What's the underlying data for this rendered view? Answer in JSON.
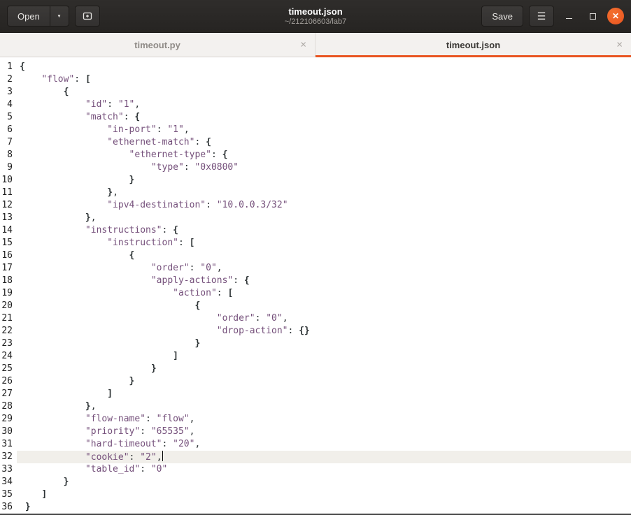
{
  "header": {
    "open_label": "Open",
    "title": "timeout.json",
    "subtitle": "~/212106603/lab7",
    "save_label": "Save"
  },
  "icons": {
    "open_dropdown": "▼",
    "menu": "☰",
    "close_window": "✕",
    "tab_close": "×"
  },
  "tabs": [
    {
      "label": "timeout.py",
      "active": false
    },
    {
      "label": "timeout.json",
      "active": true
    }
  ],
  "editor": {
    "language": "json",
    "current_line": 32,
    "lines": [
      [
        [
          "{",
          "b"
        ]
      ],
      [
        [
          "    ",
          "p"
        ],
        [
          "\"flow\"",
          "s"
        ],
        [
          ": ",
          "p"
        ],
        [
          "[",
          "b"
        ]
      ],
      [
        [
          "        ",
          "p"
        ],
        [
          "{",
          "b"
        ]
      ],
      [
        [
          "            ",
          "p"
        ],
        [
          "\"id\"",
          "s"
        ],
        [
          ": ",
          "p"
        ],
        [
          "\"1\"",
          "s"
        ],
        [
          ",",
          "p"
        ]
      ],
      [
        [
          "            ",
          "p"
        ],
        [
          "\"match\"",
          "s"
        ],
        [
          ": ",
          "p"
        ],
        [
          "{",
          "b"
        ]
      ],
      [
        [
          "                ",
          "p"
        ],
        [
          "\"in-port\"",
          "s"
        ],
        [
          ": ",
          "p"
        ],
        [
          "\"1\"",
          "s"
        ],
        [
          ",",
          "p"
        ]
      ],
      [
        [
          "                ",
          "p"
        ],
        [
          "\"ethernet-match\"",
          "s"
        ],
        [
          ": ",
          "p"
        ],
        [
          "{",
          "b"
        ]
      ],
      [
        [
          "                    ",
          "p"
        ],
        [
          "\"ethernet-type\"",
          "s"
        ],
        [
          ": ",
          "p"
        ],
        [
          "{",
          "b"
        ]
      ],
      [
        [
          "                        ",
          "p"
        ],
        [
          "\"type\"",
          "s"
        ],
        [
          ": ",
          "p"
        ],
        [
          "\"0x0800\"",
          "s"
        ]
      ],
      [
        [
          "                    ",
          "p"
        ],
        [
          "}",
          "b"
        ]
      ],
      [
        [
          "                ",
          "p"
        ],
        [
          "}",
          "b"
        ],
        [
          ",",
          "p"
        ]
      ],
      [
        [
          "                ",
          "p"
        ],
        [
          "\"ipv4-destination\"",
          "s"
        ],
        [
          ": ",
          "p"
        ],
        [
          "\"10.0.0.3/32\"",
          "s"
        ]
      ],
      [
        [
          "            ",
          "p"
        ],
        [
          "}",
          "b"
        ],
        [
          ",",
          "p"
        ]
      ],
      [
        [
          "            ",
          "p"
        ],
        [
          "\"instructions\"",
          "s"
        ],
        [
          ": ",
          "p"
        ],
        [
          "{",
          "b"
        ]
      ],
      [
        [
          "                ",
          "p"
        ],
        [
          "\"instruction\"",
          "s"
        ],
        [
          ": ",
          "p"
        ],
        [
          "[",
          "b"
        ]
      ],
      [
        [
          "                    ",
          "p"
        ],
        [
          "{",
          "b"
        ]
      ],
      [
        [
          "                        ",
          "p"
        ],
        [
          "\"order\"",
          "s"
        ],
        [
          ": ",
          "p"
        ],
        [
          "\"0\"",
          "s"
        ],
        [
          ",",
          "p"
        ]
      ],
      [
        [
          "                        ",
          "p"
        ],
        [
          "\"apply-actions\"",
          "s"
        ],
        [
          ": ",
          "p"
        ],
        [
          "{",
          "b"
        ]
      ],
      [
        [
          "                            ",
          "p"
        ],
        [
          "\"action\"",
          "s"
        ],
        [
          ": ",
          "p"
        ],
        [
          "[",
          "b"
        ]
      ],
      [
        [
          "                                ",
          "p"
        ],
        [
          "{",
          "b"
        ]
      ],
      [
        [
          "                                    ",
          "p"
        ],
        [
          "\"order\"",
          "s"
        ],
        [
          ": ",
          "p"
        ],
        [
          "\"0\"",
          "s"
        ],
        [
          ",",
          "p"
        ]
      ],
      [
        [
          "                                    ",
          "p"
        ],
        [
          "\"drop-action\"",
          "s"
        ],
        [
          ": ",
          "p"
        ],
        [
          "{}",
          "b"
        ]
      ],
      [
        [
          "                                ",
          "p"
        ],
        [
          "}",
          "b"
        ]
      ],
      [
        [
          "                            ",
          "p"
        ],
        [
          "]",
          "b"
        ]
      ],
      [
        [
          "                        ",
          "p"
        ],
        [
          "}",
          "b"
        ]
      ],
      [
        [
          "                    ",
          "p"
        ],
        [
          "}",
          "b"
        ]
      ],
      [
        [
          "                ",
          "p"
        ],
        [
          "]",
          "b"
        ]
      ],
      [
        [
          "            ",
          "p"
        ],
        [
          "}",
          "b"
        ],
        [
          ",",
          "p"
        ]
      ],
      [
        [
          "            ",
          "p"
        ],
        [
          "\"flow-name\"",
          "s"
        ],
        [
          ": ",
          "p"
        ],
        [
          "\"flow\"",
          "s"
        ],
        [
          ",",
          "p"
        ]
      ],
      [
        [
          "            ",
          "p"
        ],
        [
          "\"priority\"",
          "s"
        ],
        [
          ": ",
          "p"
        ],
        [
          "\"65535\"",
          "s"
        ],
        [
          ",",
          "p"
        ]
      ],
      [
        [
          "            ",
          "p"
        ],
        [
          "\"hard-timeout\"",
          "s"
        ],
        [
          ": ",
          "p"
        ],
        [
          "\"20\"",
          "s"
        ],
        [
          ",",
          "p"
        ]
      ],
      [
        [
          "            ",
          "p"
        ],
        [
          "\"cookie\"",
          "s"
        ],
        [
          ": ",
          "p"
        ],
        [
          "\"2\"",
          "s"
        ],
        [
          ",",
          "p"
        ]
      ],
      [
        [
          "            ",
          "p"
        ],
        [
          "\"table_id\"",
          "s"
        ],
        [
          ": ",
          "p"
        ],
        [
          "\"0\"",
          "s"
        ]
      ],
      [
        [
          "        ",
          "p"
        ],
        [
          "}",
          "b"
        ]
      ],
      [
        [
          "    ",
          "p"
        ],
        [
          "]",
          "b"
        ]
      ],
      [
        [
          " ",
          "p"
        ],
        [
          "}",
          "b"
        ]
      ]
    ]
  },
  "colors": {
    "accent_orange": "#E95420",
    "string_color": "#75507B",
    "text_color": "#2E3436",
    "current_line_bg": "#F1EFEA"
  }
}
